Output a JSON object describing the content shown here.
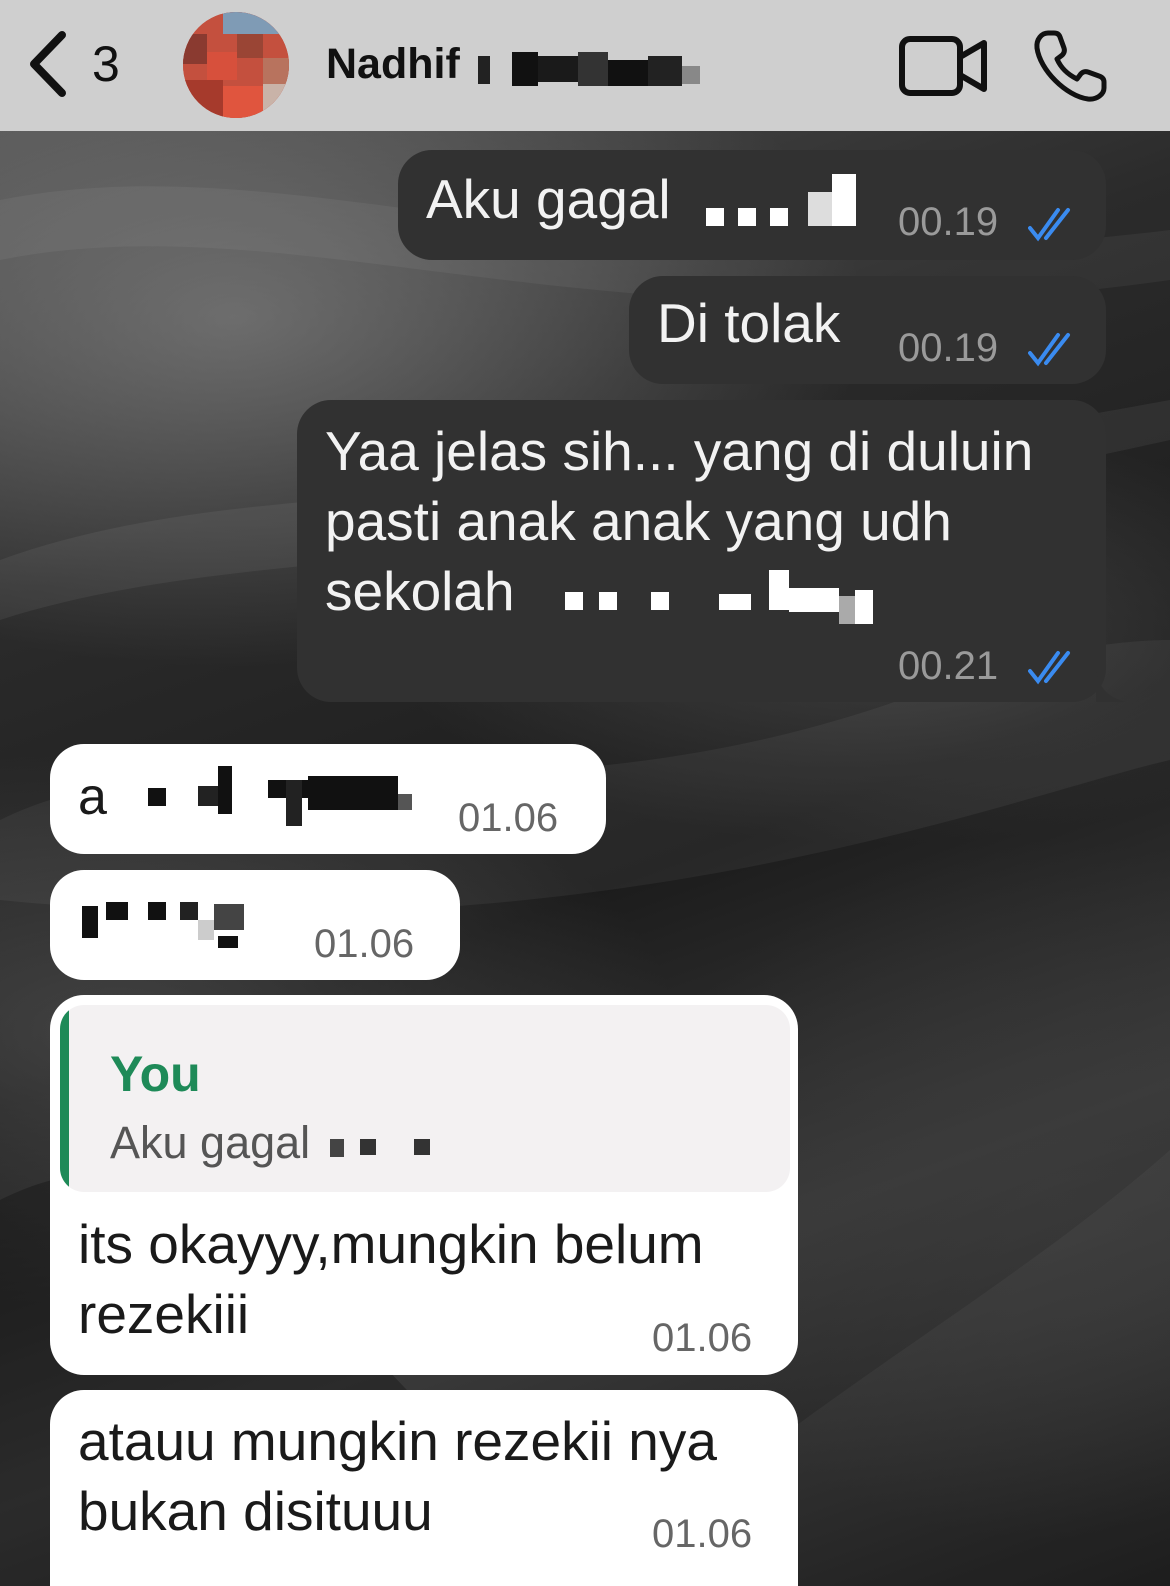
{
  "header": {
    "back_count": "3",
    "contact_name": "Nadhif",
    "icons": [
      "chevron-left-icon",
      "video-camera-icon",
      "phone-icon"
    ]
  },
  "messages": [
    {
      "direction": "outgoing",
      "text": "Aku gagal",
      "time": "00.19",
      "status": "read"
    },
    {
      "direction": "outgoing",
      "text": "Di tolak",
      "time": "00.19",
      "status": "read"
    },
    {
      "direction": "outgoing",
      "lines": [
        "Yaa jelas sih... yang di duluin",
        "pasti anak anak yang udh",
        "sekolah"
      ],
      "time": "00.21",
      "status": "read"
    },
    {
      "direction": "incoming",
      "text": "a",
      "time": "01.06"
    },
    {
      "direction": "incoming",
      "text": "",
      "time": "01.06"
    },
    {
      "direction": "incoming",
      "quote": {
        "author": "You",
        "text": "Aku gagal"
      },
      "lines": [
        "its okayyy,mungkin belum",
        "rezekiii"
      ],
      "time": "01.06"
    },
    {
      "direction": "incoming",
      "lines": [
        "atauu mungkin rezekii nya",
        "bukan disituuu"
      ],
      "time": "01.06"
    }
  ],
  "colors": {
    "header_bg": "#cfcfcf",
    "outgoing_bubble": "#313131",
    "incoming_bubble": "#ffffff",
    "read_ticks": "#3a8bf0",
    "quote_accent": "#1e8a58"
  }
}
